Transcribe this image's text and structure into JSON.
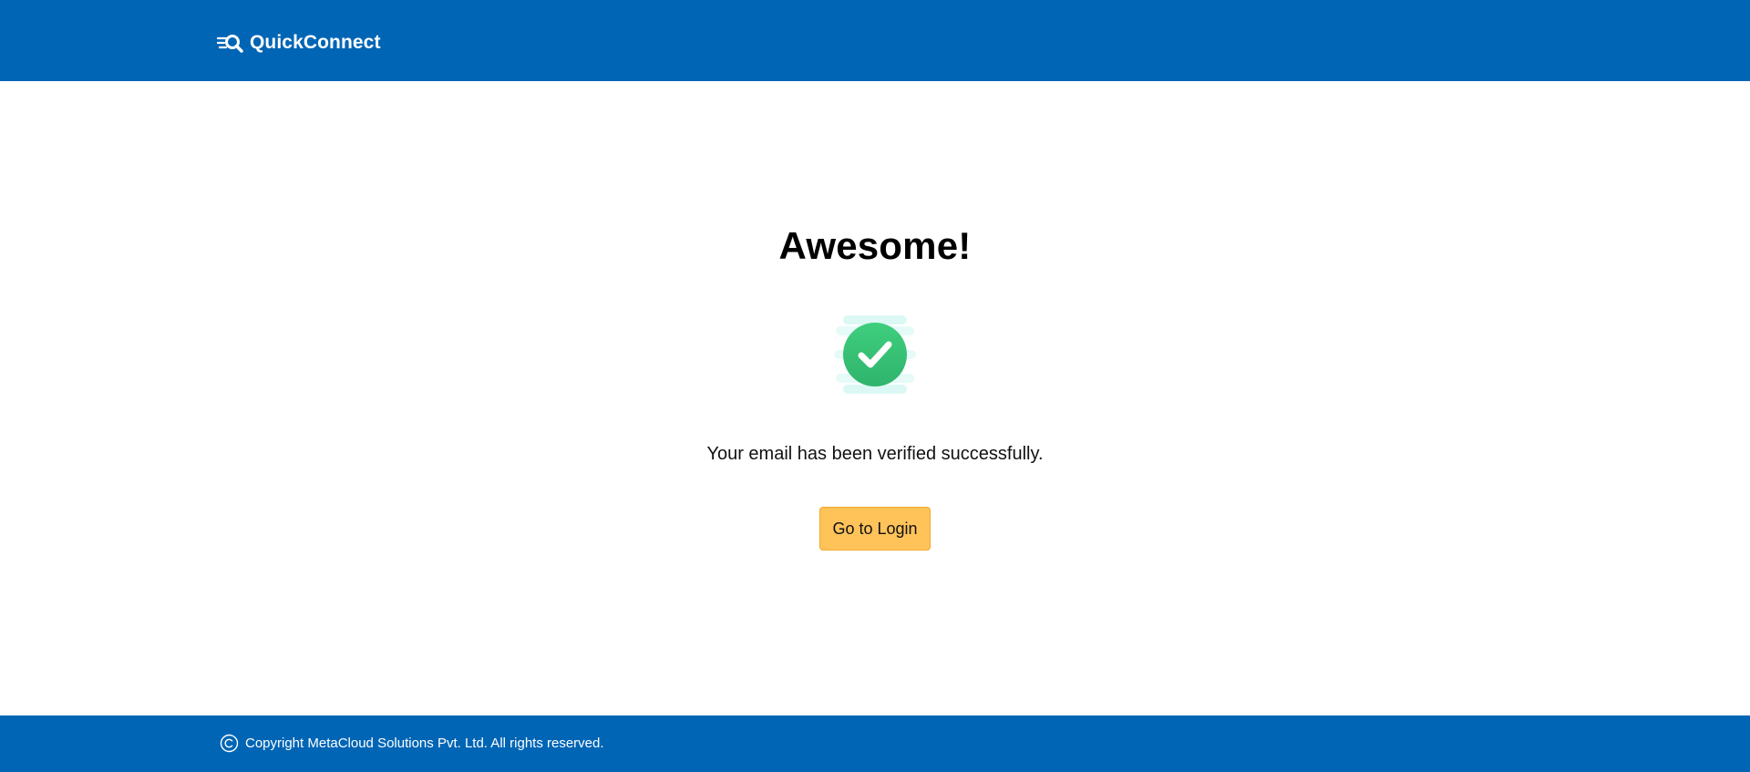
{
  "header": {
    "brand_name": "QuickConnect",
    "brand_icon": "speed-search-icon"
  },
  "main": {
    "heading": "Awesome!",
    "status_icon": "check-circle-icon",
    "message": "Your email has been verified successfully.",
    "login_button_label": "Go to Login"
  },
  "footer": {
    "copyright_icon": "copyright-icon",
    "copyright_text": "Copyright MetaCloud Solutions Pvt. Ltd. All rights reserved."
  },
  "colors": {
    "brand_blue": "#0065b5",
    "button_yellow": "#ffc35a",
    "success_green": "#3ac67a",
    "text_dark": "#000000"
  }
}
